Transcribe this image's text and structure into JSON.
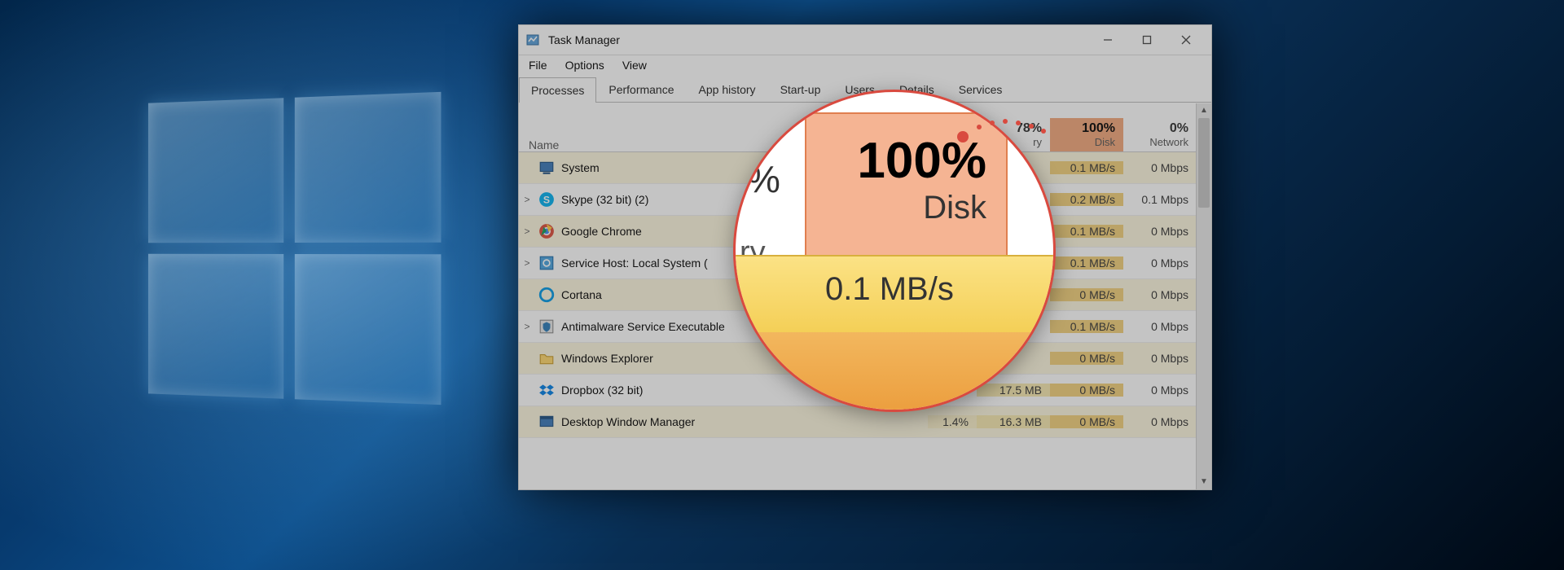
{
  "window": {
    "title": "Task Manager",
    "menus": [
      "File",
      "Options",
      "View"
    ],
    "tabs": [
      "Processes",
      "Performance",
      "App history",
      "Start-up",
      "Users",
      "Details",
      "Services"
    ],
    "active_tab": 0,
    "headers": {
      "name": "Name",
      "cpu_pct_partial": "…",
      "memory": {
        "pct": "78%",
        "label": "ry"
      },
      "disk": {
        "pct": "100%",
        "label": "Disk"
      },
      "network": {
        "pct": "0%",
        "label": "Network"
      }
    }
  },
  "processes": [
    {
      "expander": "",
      "icon": "system-icon",
      "name": "System",
      "cpu": "",
      "memory": "",
      "disk": "0.1 MB/s",
      "network": "0 Mbps"
    },
    {
      "expander": ">",
      "icon": "skype-icon",
      "name": "Skype (32 bit) (2)",
      "cpu": "",
      "memory": "",
      "disk": "0.2 MB/s",
      "network": "0.1 Mbps"
    },
    {
      "expander": ">",
      "icon": "chrome-icon",
      "name": "Google Chrome",
      "cpu": "",
      "memory": "",
      "disk": "0.1 MB/s",
      "network": "0 Mbps"
    },
    {
      "expander": ">",
      "icon": "svchost-icon",
      "name": "Service Host: Local System (",
      "cpu": "",
      "memory": "",
      "disk": "0.1 MB/s",
      "network": "0 Mbps"
    },
    {
      "expander": "",
      "icon": "cortana-icon",
      "name": "Cortana",
      "cpu": "",
      "memory": "",
      "disk": "0 MB/s",
      "network": "0 Mbps"
    },
    {
      "expander": ">",
      "icon": "defender-icon",
      "name": "Antimalware Service Executable",
      "cpu": "",
      "memory": "",
      "disk": "0.1 MB/s",
      "network": "0 Mbps"
    },
    {
      "expander": "",
      "icon": "explorer-icon",
      "name": "Windows Explorer",
      "cpu": "",
      "memory": "",
      "disk": "0 MB/s",
      "network": "0 Mbps"
    },
    {
      "expander": "",
      "icon": "dropbox-icon",
      "name": "Dropbox (32 bit)",
      "cpu": "",
      "memory": "17.5 MB",
      "disk": "0 MB/s",
      "network": "0 Mbps"
    },
    {
      "expander": "",
      "icon": "dwm-icon",
      "name": "Desktop Window Manager",
      "cpu": "1.4%",
      "memory": "16.3 MB",
      "disk": "0 MB/s",
      "network": "0 Mbps"
    }
  ],
  "zoom": {
    "pct_fragment": "%",
    "ry_fragment": "ry",
    "disk_pct": "100%",
    "disk_label": "Disk",
    "first_value": "0.1 MB/s"
  }
}
